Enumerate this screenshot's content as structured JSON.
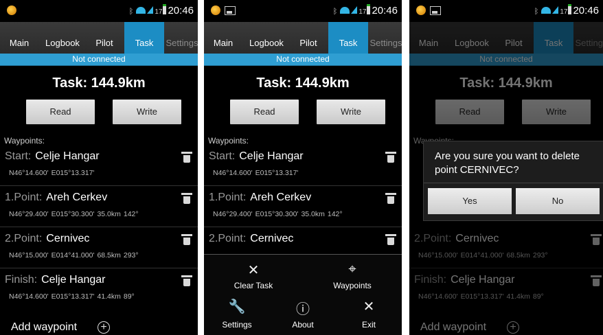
{
  "status_bar": {
    "time": "20:46",
    "battery": "17"
  },
  "tabs": [
    "Main",
    "Logbook",
    "Pilot",
    "Task",
    "Settings"
  ],
  "connection_status": "Not connected",
  "task_title": "Task: 144.9km",
  "buttons": {
    "read": "Read",
    "write": "Write"
  },
  "waypoints_label": "Waypoints:",
  "waypoints": [
    {
      "kind": "Start:",
      "name": "Celje Hangar",
      "lat": "N46°14.600'",
      "lon": "E015°13.317'",
      "dist": "",
      "bearing": ""
    },
    {
      "kind": "1.Point:",
      "name": "Areh Cerkev",
      "lat": "N46°29.400'",
      "lon": "E015°30.300'",
      "dist": "35.0km",
      "bearing": "142°"
    },
    {
      "kind": "2.Point:",
      "name": "Cernivec",
      "lat": "N46°15.000'",
      "lon": "E014°41.000'",
      "dist": "68.5km",
      "bearing": "293°"
    },
    {
      "kind": "Finish:",
      "name": "Celje Hangar",
      "lat": "N46°14.600'",
      "lon": "E015°13.317'",
      "dist": "41.4km",
      "bearing": "89°"
    }
  ],
  "add_waypoint": "Add waypoint",
  "menu": {
    "clear_task": "Clear Task",
    "waypoints": "Waypoints",
    "settings": "Settings",
    "about": "About",
    "exit": "Exit"
  },
  "dialog": {
    "message": "Are you sure you want to delete point CERNIVEC?",
    "yes": "Yes",
    "no": "No"
  },
  "colors": {
    "accent": "#1c8dc4",
    "status_bar": "#2f9ed2",
    "background": "#000000"
  }
}
